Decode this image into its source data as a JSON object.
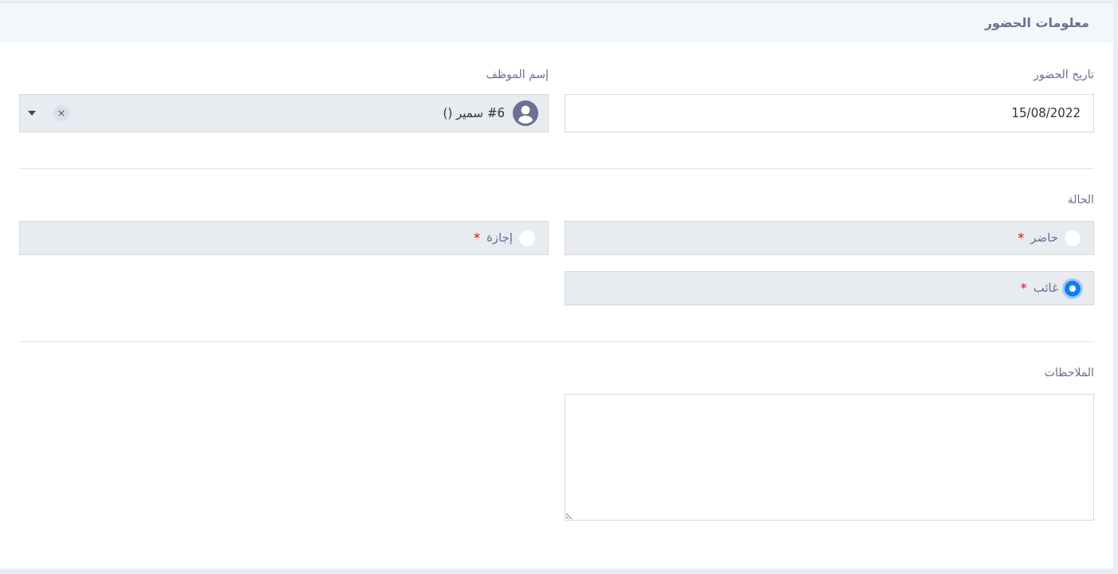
{
  "section": {
    "title": "معلومات الحضور"
  },
  "date_field": {
    "label": "تاريخ الحضور",
    "value": "15/08/2022"
  },
  "employee_field": {
    "label": "إسم الموظف",
    "value": "#6 سمير ()",
    "clear": "×"
  },
  "status": {
    "label": "الحالة",
    "options": [
      {
        "label": "حاضر",
        "required_mark": "*",
        "selected": false
      },
      {
        "label": "إجازة",
        "required_mark": "*",
        "selected": false
      },
      {
        "label": "غائب",
        "required_mark": "*",
        "selected": true
      }
    ]
  },
  "notes": {
    "label": "الملاحظات"
  }
}
